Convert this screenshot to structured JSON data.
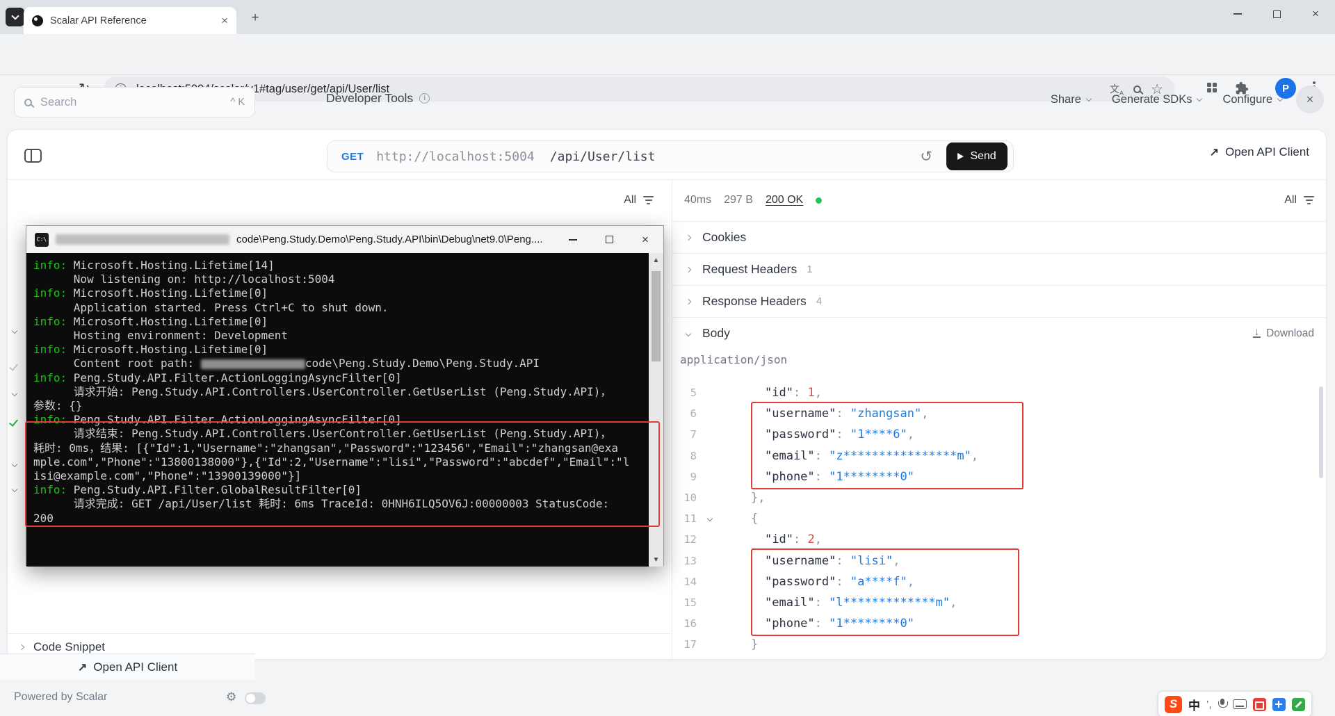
{
  "browser": {
    "tab_title": "Scalar API Reference",
    "url": "localhost:5004/scalar/v1#tag/user/get/api/User/list",
    "profile_initial": "P"
  },
  "scalar": {
    "search_placeholder": "Search",
    "search_shortcut": "^ K",
    "dev_tools_label": "Developer Tools",
    "share_label": "Share",
    "generate_sdks_label": "Generate SDKs",
    "configure_label": "Configure",
    "method": "GET",
    "base_url": "http://localhost:5004",
    "path": "/api/User/list",
    "send_label": "Send",
    "open_api_client_label": "Open API Client",
    "request_filter_label": "All",
    "response": {
      "time": "40ms",
      "size": "297 B",
      "status": "200 OK",
      "filter_label": "All",
      "sections": [
        {
          "label": "Cookies",
          "badge": ""
        },
        {
          "label": "Request Headers",
          "badge": "1"
        },
        {
          "label": "Response Headers",
          "badge": "4"
        }
      ],
      "body_label": "Body",
      "download_label": "Download",
      "content_type": "application/json"
    },
    "code_snippet_label": "Code Snippet",
    "footer_open_api_client": "Open API Client",
    "powered_by": "Powered by Scalar"
  },
  "body_code": {
    "lines": [
      {
        "num": 5,
        "ind": 4,
        "tokens": [
          {
            "c": "key",
            "t": "\"id\""
          },
          {
            "c": "pun",
            "t": ": "
          },
          {
            "c": "num",
            "t": "1"
          },
          {
            "c": "pun",
            "t": ","
          }
        ]
      },
      {
        "num": 6,
        "ind": 4,
        "tokens": [
          {
            "c": "key",
            "t": "\"username\""
          },
          {
            "c": "pun",
            "t": ": "
          },
          {
            "c": "str",
            "t": "\"zhangsan\""
          },
          {
            "c": "pun",
            "t": ","
          }
        ]
      },
      {
        "num": 7,
        "ind": 4,
        "tokens": [
          {
            "c": "key",
            "t": "\"password\""
          },
          {
            "c": "pun",
            "t": ": "
          },
          {
            "c": "str",
            "t": "\"1****6\""
          },
          {
            "c": "pun",
            "t": ","
          }
        ]
      },
      {
        "num": 8,
        "ind": 4,
        "tokens": [
          {
            "c": "key",
            "t": "\"email\""
          },
          {
            "c": "pun",
            "t": ": "
          },
          {
            "c": "str",
            "t": "\"z****************m\""
          },
          {
            "c": "pun",
            "t": ","
          }
        ]
      },
      {
        "num": 9,
        "ind": 4,
        "tokens": [
          {
            "c": "key",
            "t": "\"phone\""
          },
          {
            "c": "pun",
            "t": ": "
          },
          {
            "c": "str",
            "t": "\"1********0\""
          }
        ]
      },
      {
        "num": 10,
        "ind": 2,
        "tokens": [
          {
            "c": "pun",
            "t": "},"
          }
        ]
      },
      {
        "num": 11,
        "ind": 2,
        "collapse": true,
        "tokens": [
          {
            "c": "pun",
            "t": "{"
          }
        ]
      },
      {
        "num": 12,
        "ind": 4,
        "tokens": [
          {
            "c": "key",
            "t": "\"id\""
          },
          {
            "c": "pun",
            "t": ": "
          },
          {
            "c": "num",
            "t": "2"
          },
          {
            "c": "pun",
            "t": ","
          }
        ]
      },
      {
        "num": 13,
        "ind": 4,
        "tokens": [
          {
            "c": "key",
            "t": "\"username\""
          },
          {
            "c": "pun",
            "t": ": "
          },
          {
            "c": "str",
            "t": "\"lisi\""
          },
          {
            "c": "pun",
            "t": ","
          }
        ]
      },
      {
        "num": 14,
        "ind": 4,
        "tokens": [
          {
            "c": "key",
            "t": "\"password\""
          },
          {
            "c": "pun",
            "t": ": "
          },
          {
            "c": "str",
            "t": "\"a****f\""
          },
          {
            "c": "pun",
            "t": ","
          }
        ]
      },
      {
        "num": 15,
        "ind": 4,
        "tokens": [
          {
            "c": "key",
            "t": "\"email\""
          },
          {
            "c": "pun",
            "t": ": "
          },
          {
            "c": "str",
            "t": "\"l*************m\""
          },
          {
            "c": "pun",
            "t": ","
          }
        ]
      },
      {
        "num": 16,
        "ind": 4,
        "tokens": [
          {
            "c": "key",
            "t": "\"phone\""
          },
          {
            "c": "pun",
            "t": ": "
          },
          {
            "c": "str",
            "t": "\"1********0\""
          }
        ]
      },
      {
        "num": 17,
        "ind": 2,
        "tokens": [
          {
            "c": "pun",
            "t": "}"
          }
        ]
      }
    ]
  },
  "console": {
    "title": "code\\Peng.Study.Demo\\Peng.Study.API\\bin\\Debug\\net9.0\\Peng....",
    "lines": [
      {
        "parts": [
          {
            "c": "g",
            "t": "info: "
          },
          {
            "c": "w",
            "t": "Microsoft.Hosting.Lifetime[14]"
          }
        ]
      },
      {
        "parts": [
          {
            "c": "w",
            "t": "      Now listening on: http://localhost:5004"
          }
        ]
      },
      {
        "parts": [
          {
            "c": "g",
            "t": "info: "
          },
          {
            "c": "w",
            "t": "Microsoft.Hosting.Lifetime[0]"
          }
        ]
      },
      {
        "parts": [
          {
            "c": "w",
            "t": "      Application started. Press Ctrl+C to shut down."
          }
        ]
      },
      {
        "parts": [
          {
            "c": "g",
            "t": "info: "
          },
          {
            "c": "w",
            "t": "Microsoft.Hosting.Lifetime[0]"
          }
        ]
      },
      {
        "parts": [
          {
            "c": "w",
            "t": "      Hosting environment: Development"
          }
        ]
      },
      {
        "parts": [
          {
            "c": "g",
            "t": "info: "
          },
          {
            "c": "w",
            "t": "Microsoft.Hosting.Lifetime[0]"
          }
        ]
      },
      {
        "parts": [
          {
            "c": "w",
            "t": "      Content root path: "
          },
          {
            "c": "r",
            "w": 150
          },
          {
            "c": "w",
            "t": "code\\Peng.Study.Demo\\Peng.Study.API"
          }
        ]
      },
      {
        "parts": [
          {
            "c": "g",
            "t": "info: "
          },
          {
            "c": "w",
            "t": "Peng.Study.API.Filter.ActionLoggingAsyncFilter[0]"
          }
        ]
      },
      {
        "parts": [
          {
            "c": "w",
            "t": "      请求开始: Peng.Study.API.Controllers.UserController.GetUserList (Peng.Study.API)，"
          }
        ]
      },
      {
        "parts": [
          {
            "c": "w",
            "t": "参数: {}"
          }
        ]
      },
      {
        "parts": [
          {
            "c": "g",
            "t": "info: "
          },
          {
            "c": "w",
            "t": "Peng.Study.API.Filter.ActionLoggingAsyncFilter[0]"
          }
        ]
      },
      {
        "parts": [
          {
            "c": "w",
            "t": "      请求结束: Peng.Study.API.Controllers.UserController.GetUserList (Peng.Study.API)，"
          }
        ]
      },
      {
        "parts": [
          {
            "c": "w",
            "t": "耗时: 0ms，结果: [{\"Id\":1,\"Username\":\"zhangsan\",\"Password\":\"123456\",\"Email\":\"zhangsan@exa"
          }
        ]
      },
      {
        "parts": [
          {
            "c": "w",
            "t": "mple.com\",\"Phone\":\"13800138000\"},{\"Id\":2,\"Username\":\"lisi\",\"Password\":\"abcdef\",\"Email\":\"l"
          }
        ]
      },
      {
        "parts": [
          {
            "c": "w",
            "t": "isi@example.com\",\"Phone\":\"13900139000\"}]"
          }
        ]
      },
      {
        "parts": [
          {
            "c": "g",
            "t": "info: "
          },
          {
            "c": "w",
            "t": "Peng.Study.API.Filter.GlobalResultFilter[0]"
          }
        ]
      },
      {
        "parts": [
          {
            "c": "w",
            "t": "      请求完成: GET /api/User/list 耗时: 6ms TraceId: 0HNH6ILQ5OV6J:00000003 StatusCode:"
          }
        ]
      },
      {
        "parts": [
          {
            "c": "w",
            "t": "200"
          }
        ]
      }
    ]
  },
  "ime": {
    "input_source": "S",
    "mode": "中",
    "punct": "’,"
  }
}
